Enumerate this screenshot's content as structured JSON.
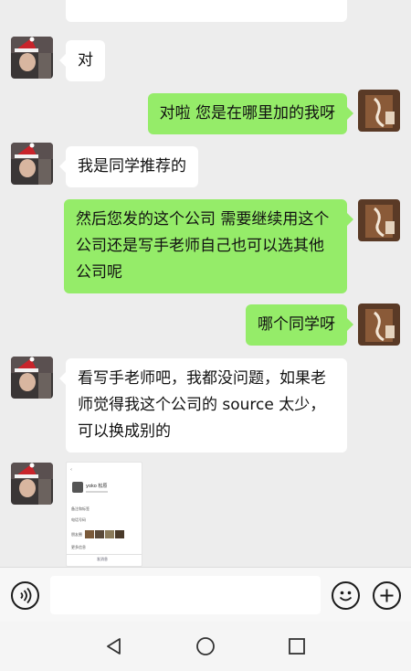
{
  "messages": [
    {
      "side": "received",
      "text": "对"
    },
    {
      "side": "sent",
      "text": "对啦 您是在哪里加的我呀"
    },
    {
      "side": "received",
      "text": "我是同学推荐的"
    },
    {
      "side": "sent",
      "text": "然后您发的这个公司 需要继续用这个公司还是写手老师自己也可以选其他公司呢"
    },
    {
      "side": "sent",
      "text": "哪个同学呀"
    },
    {
      "side": "received",
      "text": "看写手老师吧，我都没问题，如果老师觉得我这个公司的 source 太少，可以换成别的"
    },
    {
      "side": "received",
      "type": "image",
      "text": ""
    }
  ],
  "screenshot_thumb": {
    "profile_name": "yoko 松原",
    "rows": [
      "备注和标签",
      "电话号码",
      "朋友圈",
      "更多信息"
    ],
    "footer": "发消息"
  },
  "icons": {
    "voice": "voice-icon",
    "emoji": "emoji-icon",
    "plus": "plus-icon",
    "back": "back-triangle-icon",
    "home": "home-circle-icon",
    "recents": "recents-square-icon"
  },
  "colors": {
    "sent_bubble": "#95ec69",
    "received_bubble": "#ffffff",
    "background": "#ededed"
  }
}
